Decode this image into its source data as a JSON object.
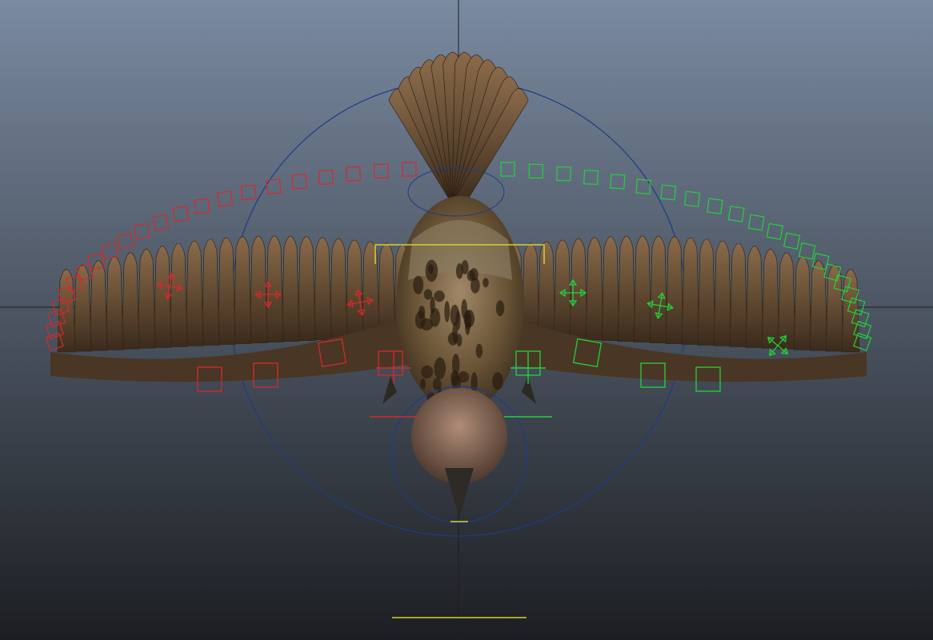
{
  "viewport": {
    "name": "3D viewport",
    "background_top": "#7a8aa0",
    "background_bottom": "#1c1e22",
    "axis_color": "#1e1e1e"
  },
  "colors": {
    "left_controls": "#d42a2a",
    "right_controls": "#22d23a",
    "root_circle": "#1c3c8a",
    "center_controls": "#d8d22a",
    "feather_dark": "#3b2b1c",
    "feather_light": "#8a6a4a",
    "body": "#7a6a50",
    "head": "#9a7a66"
  },
  "icons": {
    "move": "four-way-arrow-icon",
    "rotate": "square-control-icon",
    "root": "circle-control-icon"
  },
  "rig": {
    "sides": [
      "left",
      "right"
    ],
    "wing_feather_count": 22,
    "tail_feather_count": 12,
    "left_arc_controls": 22,
    "right_arc_controls": 22,
    "left_move_controls": 3,
    "right_move_controls": 3,
    "left_wing_squares": 4,
    "right_wing_squares": 4
  }
}
